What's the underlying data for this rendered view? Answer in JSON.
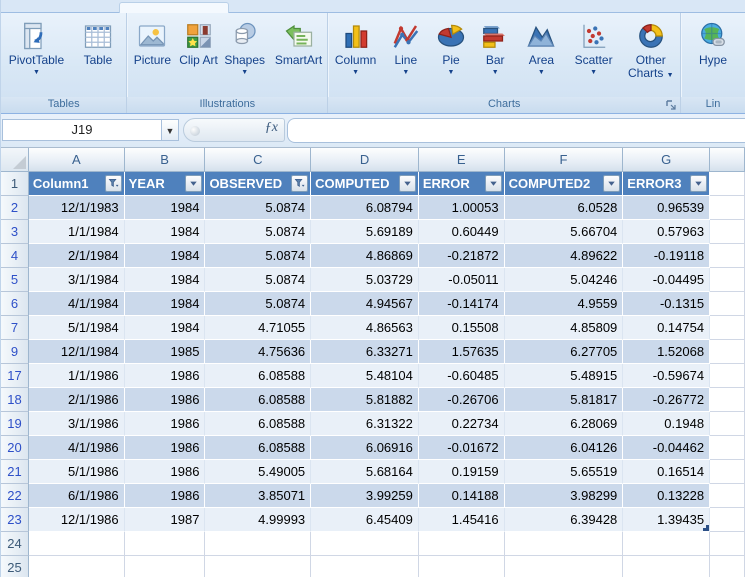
{
  "ribbon": {
    "groups": [
      {
        "label": "Tables",
        "buttons": [
          {
            "label": "PivotTable"
          },
          {
            "label": "Table"
          }
        ]
      },
      {
        "label": "Illustrations",
        "buttons": [
          {
            "label": "Picture"
          },
          {
            "label": "Clip Art"
          },
          {
            "label": "Shapes"
          },
          {
            "label": "SmartArt"
          }
        ]
      },
      {
        "label": "Charts",
        "buttons": [
          {
            "label": "Column"
          },
          {
            "label": "Line"
          },
          {
            "label": "Pie"
          },
          {
            "label": "Bar"
          },
          {
            "label": "Area"
          },
          {
            "label": "Scatter"
          },
          {
            "label": "Other Charts"
          }
        ]
      },
      {
        "label": "Lin",
        "buttons": [
          {
            "label": "Hype"
          }
        ]
      }
    ]
  },
  "formula_bar": {
    "name_box_value": "J19",
    "fx_glyph": "ƒx"
  },
  "sheet": {
    "column_letters": [
      "A",
      "B",
      "C",
      "D",
      "E",
      "F",
      "G"
    ],
    "header_row_number": "1",
    "headers": [
      {
        "label": "Column1",
        "filter": "funnel"
      },
      {
        "label": "YEAR",
        "filter": "arrow"
      },
      {
        "label": "OBSERVED",
        "filter": "funnel"
      },
      {
        "label": "COMPUTED",
        "filter": "arrow"
      },
      {
        "label": "ERROR",
        "filter": "arrow"
      },
      {
        "label": "COMPUTED2",
        "filter": "arrow"
      },
      {
        "label": "ERROR3",
        "filter": "arrow"
      }
    ],
    "rows": [
      {
        "n": "2",
        "cells": [
          "12/1/1983",
          "1984",
          "5.0874",
          "6.08794",
          "1.00053",
          "6.0528",
          "0.96539"
        ]
      },
      {
        "n": "3",
        "cells": [
          "1/1/1984",
          "1984",
          "5.0874",
          "5.69189",
          "0.60449",
          "5.66704",
          "0.57963"
        ]
      },
      {
        "n": "4",
        "cells": [
          "2/1/1984",
          "1984",
          "5.0874",
          "4.86869",
          "-0.21872",
          "4.89622",
          "-0.19118"
        ]
      },
      {
        "n": "5",
        "cells": [
          "3/1/1984",
          "1984",
          "5.0874",
          "5.03729",
          "-0.05011",
          "5.04246",
          "-0.04495"
        ]
      },
      {
        "n": "6",
        "cells": [
          "4/1/1984",
          "1984",
          "5.0874",
          "4.94567",
          "-0.14174",
          "4.9559",
          "-0.1315"
        ]
      },
      {
        "n": "7",
        "cells": [
          "5/1/1984",
          "1984",
          "4.71055",
          "4.86563",
          "0.15508",
          "4.85809",
          "0.14754"
        ]
      },
      {
        "n": "9",
        "cells": [
          "12/1/1984",
          "1985",
          "4.75636",
          "6.33271",
          "1.57635",
          "6.27705",
          "1.52068"
        ]
      },
      {
        "n": "17",
        "cells": [
          "1/1/1986",
          "1986",
          "6.08588",
          "5.48104",
          "-0.60485",
          "5.48915",
          "-0.59674"
        ]
      },
      {
        "n": "18",
        "cells": [
          "2/1/1986",
          "1986",
          "6.08588",
          "5.81882",
          "-0.26706",
          "5.81817",
          "-0.26772"
        ]
      },
      {
        "n": "19",
        "cells": [
          "3/1/1986",
          "1986",
          "6.08588",
          "6.31322",
          "0.22734",
          "6.28069",
          "0.1948"
        ]
      },
      {
        "n": "20",
        "cells": [
          "4/1/1986",
          "1986",
          "6.08588",
          "6.06916",
          "-0.01672",
          "6.04126",
          "-0.04462"
        ]
      },
      {
        "n": "21",
        "cells": [
          "5/1/1986",
          "1986",
          "5.49005",
          "5.68164",
          "0.19159",
          "5.65519",
          "0.16514"
        ]
      },
      {
        "n": "22",
        "cells": [
          "6/1/1986",
          "1986",
          "3.85071",
          "3.99259",
          "0.14188",
          "3.98299",
          "0.13228"
        ]
      },
      {
        "n": "23",
        "cells": [
          "12/1/1986",
          "1987",
          "4.99993",
          "6.45409",
          "1.45416",
          "6.39428",
          "1.39435"
        ]
      }
    ],
    "empty_row_numbers": [
      "24",
      "25"
    ]
  },
  "colors": {
    "table_header": "#4f81bd",
    "header_text": "#ffffff",
    "band_row": "#cbd9eb",
    "light_row": "#e9f0f8",
    "filtered_row_number": "#2e50c8",
    "grid_line": "#d0d7e5",
    "ribbon_text": "#15428b",
    "group_label_text": "#3e6d9c"
  }
}
